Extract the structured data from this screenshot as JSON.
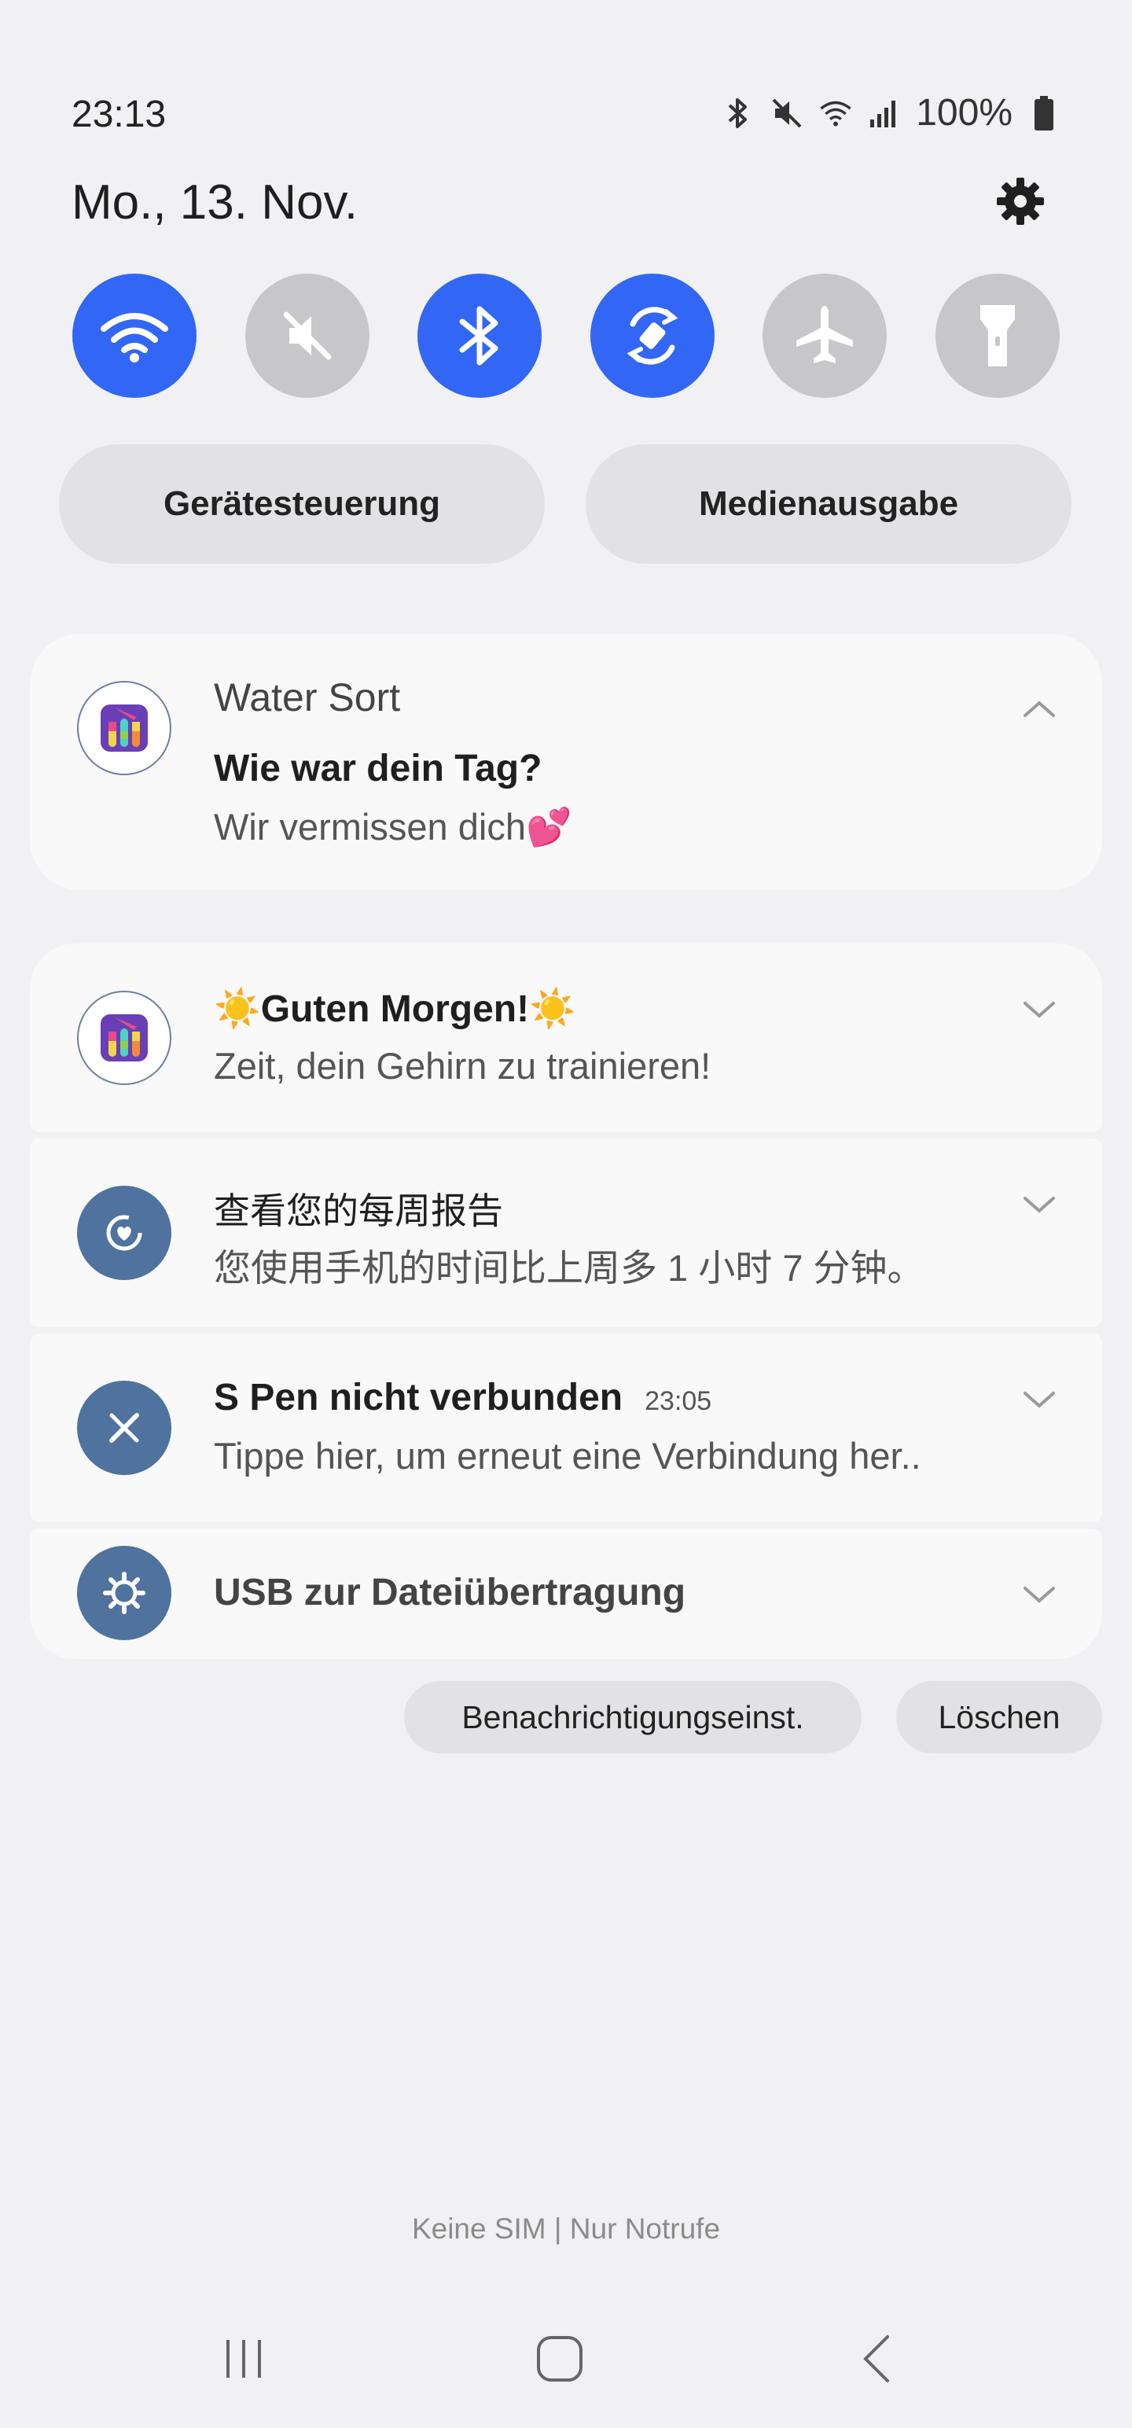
{
  "status_bar": {
    "time": "23:13",
    "battery": "100%",
    "icons": [
      "bluetooth-icon",
      "mute-icon",
      "wifi-icon",
      "signal-icon",
      "battery-icon"
    ]
  },
  "header": {
    "date": "Mo., 13. Nov.",
    "settings_icon": "gear-icon"
  },
  "quick_toggles": [
    {
      "name": "wifi",
      "state": "on"
    },
    {
      "name": "sound-muted",
      "state": "off"
    },
    {
      "name": "bluetooth",
      "state": "on"
    },
    {
      "name": "auto-rotate",
      "state": "on"
    },
    {
      "name": "airplane-mode",
      "state": "off"
    },
    {
      "name": "flashlight",
      "state": "off"
    }
  ],
  "buttons": {
    "device_control": "Gerätesteuerung",
    "media_output": "Medienausgabe"
  },
  "notifications": {
    "water_sort": {
      "app": "Water Sort",
      "title": "Wie war dein Tag?",
      "body": "Wir vermissen dich💕"
    },
    "morning": {
      "title": "☀️Guten Morgen!☀️",
      "body": "Zeit, dein Gehirn zu trainieren!"
    },
    "weekly_report": {
      "title": "查看您的每周报告",
      "body": "您使用手机的时间比上周多 1 小时 7 分钟。"
    },
    "spen": {
      "title": "S Pen nicht verbunden",
      "time": "23:05",
      "body": "Tippe hier, um erneut eine Verbindung her.."
    },
    "usb": {
      "title": "USB zur Dateiübertragung"
    }
  },
  "footer_buttons": {
    "notification_settings": "Benachrichtigungseinst.",
    "clear": "Löschen"
  },
  "carrier": "Keine SIM | Nur Notrufe",
  "colors": {
    "toggle_on": "#3266f5",
    "toggle_off": "#c7c7c9",
    "system_icon_bg": "#4f729f",
    "background": "#f1f1f3"
  }
}
